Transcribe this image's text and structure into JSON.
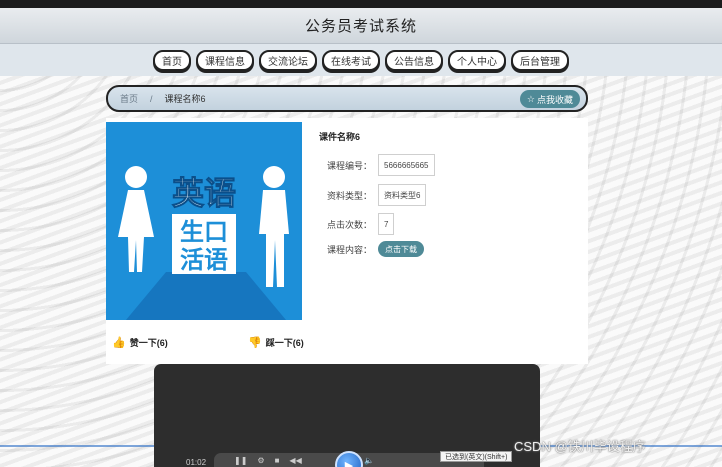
{
  "header": {
    "title": "公务员考试系统"
  },
  "nav": {
    "items": [
      "首页",
      "课程信息",
      "交流论坛",
      "在线考试",
      "公告信息",
      "个人中心",
      "后台管理"
    ]
  },
  "breadcrumb": {
    "home": "首页",
    "separator": "/",
    "current": "课程名称6",
    "favorite_label": "点我收藏"
  },
  "course": {
    "name": "课件名称6",
    "cover_text_top": "英语",
    "cover_text_bottom": [
      "生口",
      "活语"
    ],
    "fields": [
      {
        "label": "课程编号：",
        "value": "5666665665"
      },
      {
        "label": "资料类型：",
        "value": "资料类型6"
      },
      {
        "label": "点击次数：",
        "value": "7"
      }
    ],
    "content_label": "课程内容：",
    "download_label": "点击下载"
  },
  "votes": {
    "up_label": "赞一下(6)",
    "down_label": "踩一下(6)"
  },
  "player": {
    "time": "01:02",
    "tooltip": "已选到(英文)(Shift+)"
  },
  "watermark": "CSDN @铁川毕设程序"
}
